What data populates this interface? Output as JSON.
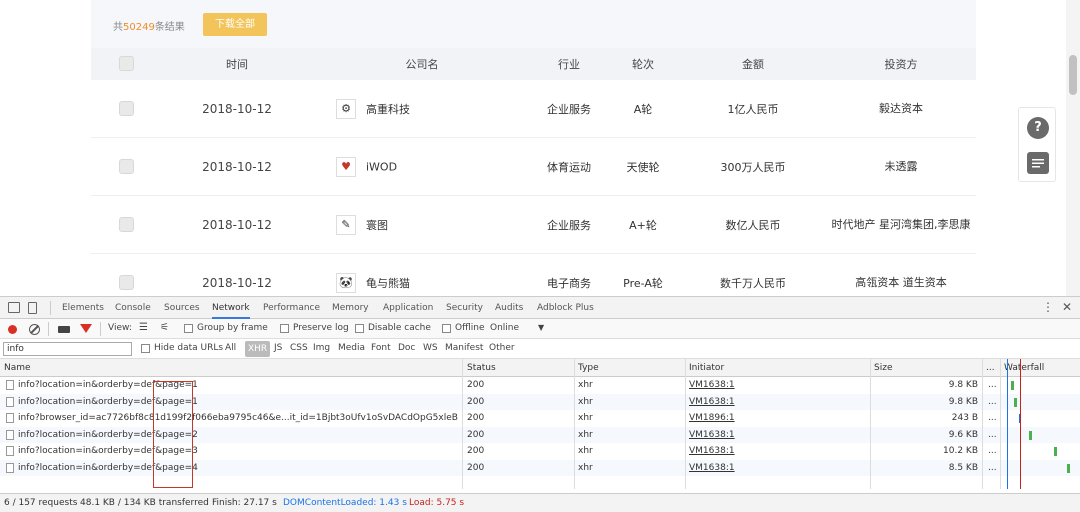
{
  "summary": {
    "prefix": "共",
    "count": "50249",
    "suffix": "条结果",
    "download_label": "下载全部"
  },
  "table": {
    "columns": [
      "时间",
      "公司名",
      "行业",
      "轮次",
      "金额",
      "投资方"
    ],
    "rows": [
      {
        "date": "2018-10-12",
        "logo": "⚙",
        "company": "高重科技",
        "industry": "企业服务",
        "round": "A轮",
        "amount": "1亿人民币",
        "investor": "毅达资本"
      },
      {
        "date": "2018-10-12",
        "logo": "♥",
        "company": "iWOD",
        "industry": "体育运动",
        "round": "天使轮",
        "amount": "300万人民币",
        "investor": "未透露"
      },
      {
        "date": "2018-10-12",
        "logo": "✎",
        "company": "寰图",
        "industry": "企业服务",
        "round": "A+轮",
        "amount": "数亿人民币",
        "investor": "时代地产 星河湾集团,李思康"
      },
      {
        "date": "2018-10-12",
        "logo": "🐼",
        "company": "龟与熊猫",
        "industry": "电子商务",
        "round": "Pre-A轮",
        "amount": "数千万人民币",
        "investor": "高瓴资本 道生资本"
      }
    ]
  },
  "float_buttons": {
    "help_icon": "?",
    "feedback_icon": "chat-icon"
  },
  "devtools": {
    "tabs": [
      "Elements",
      "Console",
      "Sources",
      "Network",
      "Performance",
      "Memory",
      "Application",
      "Security",
      "Audits",
      "Adblock Plus"
    ],
    "active_tab": "Network",
    "toolbar": {
      "view_label": "View:",
      "group_by_frame": "Group by frame",
      "preserve_log": "Preserve log",
      "disable_cache": "Disable cache",
      "offline": "Offline",
      "online": "Online"
    },
    "filter": {
      "value": "info",
      "hide_data_urls": "Hide data URLs",
      "types": [
        "All",
        "XHR",
        "JS",
        "CSS",
        "Img",
        "Media",
        "Font",
        "Doc",
        "WS",
        "Manifest",
        "Other"
      ],
      "active_type": "XHR"
    },
    "columns": [
      "Name",
      "Status",
      "Type",
      "Initiator",
      "Size",
      "...",
      "Waterfall"
    ],
    "requests": [
      {
        "name": "info?location=in&orderby=def&page=1",
        "status": "200",
        "type": "xhr",
        "initiator": "VM1638:1",
        "size": "9.8 KB",
        "more": "..."
      },
      {
        "name": "info?location=in&orderby=def&page=1",
        "status": "200",
        "type": "xhr",
        "initiator": "VM1638:1",
        "size": "9.8 KB",
        "more": "..."
      },
      {
        "name": "info?browser_id=ac7726bf8c81d199f2f066eba9795c46&e...it_id=1Bjbt3oUfv1oSvDACdOpG5xleBb&t=1...",
        "status": "200",
        "type": "xhr",
        "initiator": "VM1896:1",
        "size": "243 B",
        "more": "..."
      },
      {
        "name": "info?location=in&orderby=def&page=2",
        "status": "200",
        "type": "xhr",
        "initiator": "VM1638:1",
        "size": "9.6 KB",
        "more": "..."
      },
      {
        "name": "info?location=in&orderby=def&page=3",
        "status": "200",
        "type": "xhr",
        "initiator": "VM1638:1",
        "size": "10.2 KB",
        "more": "..."
      },
      {
        "name": "info?location=in&orderby=def&page=4",
        "status": "200",
        "type": "xhr",
        "initiator": "VM1638:1",
        "size": "8.5 KB",
        "more": "..."
      }
    ],
    "status": {
      "requests": "6 / 157 requests",
      "transferred": "48.1 KB / 134 KB transferred",
      "finish": "Finish: 27.17 s",
      "dom": "DOMContentLoaded: 1.43 s",
      "load": "Load: 5.75 s"
    }
  },
  "colors": {
    "accent": "#f2c45a",
    "count": "#f08c2a",
    "network_tab": "#3879d9",
    "highlight": "#c0392b"
  }
}
